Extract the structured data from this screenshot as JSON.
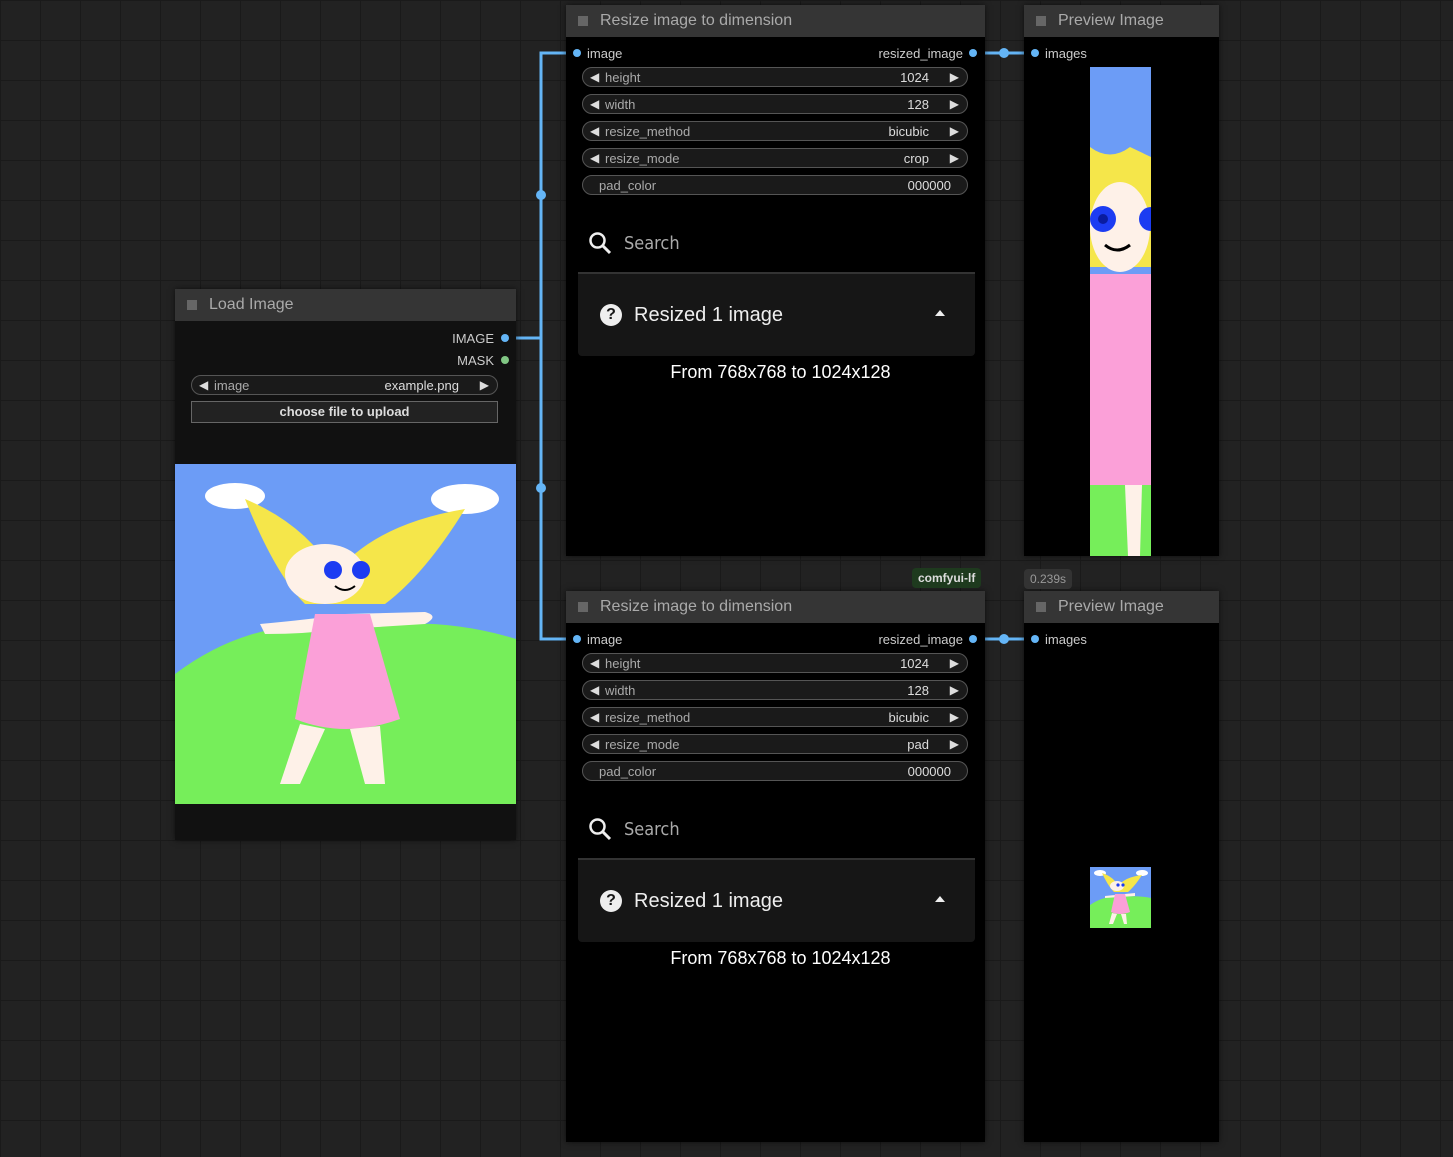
{
  "load_image": {
    "title": "Load Image",
    "outputs": [
      "IMAGE",
      "MASK"
    ],
    "image_widget": {
      "name": "image",
      "value": "example.png"
    },
    "upload_button": "choose file to upload"
  },
  "resize_nodes": [
    {
      "title": "Resize image to dimension",
      "input": "image",
      "output": "resized_image",
      "widgets": [
        {
          "name": "height",
          "value": "1024"
        },
        {
          "name": "width",
          "value": "128"
        },
        {
          "name": "resize_method",
          "value": "bicubic"
        },
        {
          "name": "resize_mode",
          "value": "crop"
        },
        {
          "name": "pad_color",
          "value": "000000"
        }
      ],
      "search_placeholder": "Search",
      "result_title": "Resized 1 image",
      "result_detail": "From 768x768 to 1024x128"
    },
    {
      "title": "Resize image to dimension",
      "input": "image",
      "output": "resized_image",
      "widgets": [
        {
          "name": "height",
          "value": "1024"
        },
        {
          "name": "width",
          "value": "128"
        },
        {
          "name": "resize_method",
          "value": "bicubic"
        },
        {
          "name": "resize_mode",
          "value": "pad"
        },
        {
          "name": "pad_color",
          "value": "000000"
        }
      ],
      "search_placeholder": "Search",
      "result_title": "Resized 1 image",
      "result_detail": "From 768x768 to 1024x128"
    }
  ],
  "preview_nodes": [
    {
      "title": "Preview Image",
      "input": "images"
    },
    {
      "title": "Preview Image",
      "input": "images"
    }
  ],
  "badges": {
    "group_label": "comfyui-lf",
    "timing": "0.239s"
  },
  "colors": {
    "image_link": "#64b5f6",
    "mask_slot": "#81c784",
    "canvas_bg": "#222222",
    "node_header": "#353535",
    "badge_bg": "#1e3a1e"
  }
}
